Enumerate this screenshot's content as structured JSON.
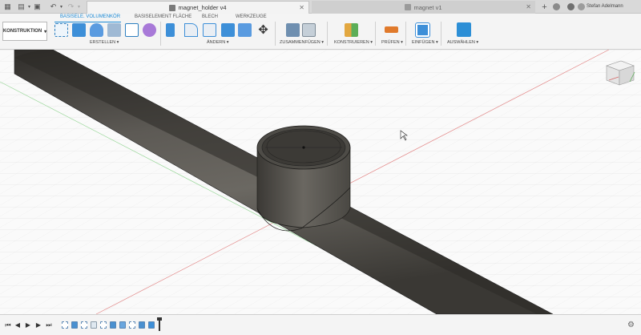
{
  "app": {
    "tabs": [
      {
        "label": "magnet_holder v4",
        "active": true
      },
      {
        "label": "magnet v1",
        "active": false
      }
    ],
    "user_name": "Stefan Adelmann"
  },
  "toolbar": {
    "workspace": "KONSTRUKTION",
    "ribbon_tabs": [
      "BASISELE. VOLUMENKÖR",
      "BASISELEMENT FLÄCHE",
      "BLECH",
      "WERKZEUGE"
    ],
    "groups": [
      "ERSTELLEN ▾",
      "ÄNDERN ▾",
      "ZUSAMMENFÜGEN ▾",
      "KONSTRUIEREN ▾",
      "PRÜFEN ▾",
      "EINFÜGEN ▾",
      "AUSWÄHLEN ▾"
    ]
  },
  "colors": {
    "accent": "#1b8ad6",
    "model_dark": "#3d3b37",
    "model_mid": "#5f5c56",
    "grid": "#d9d9d9"
  },
  "icons": {
    "grid_menu": "apps-grid-icon",
    "file": "file-icon",
    "save": "save-icon",
    "undo": "undo-icon",
    "redo": "redo-icon",
    "new_tab": "plus-icon",
    "job_status": "cloud-icon",
    "help": "help-icon",
    "view_cube": "view-cube-icon",
    "settings": "gear-icon"
  }
}
